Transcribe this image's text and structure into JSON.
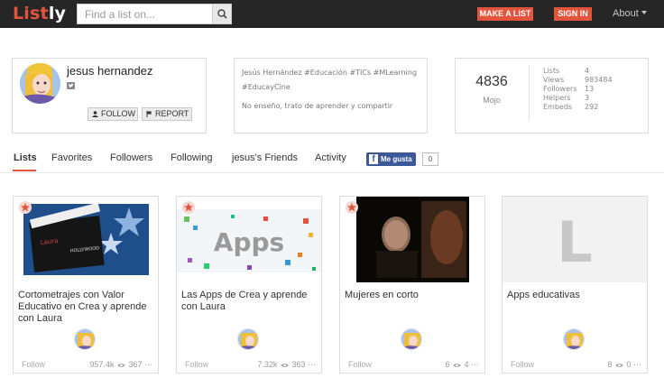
{
  "header": {
    "logo_main": "List",
    "logo_suffix": "ly",
    "search_placeholder": "Find a list on...",
    "make_list_label": "MAKE A LIST",
    "sign_in_label": "SIGN IN",
    "about_label": "About"
  },
  "profile": {
    "name": "jesus hernandez",
    "follow_label": "FOLLOW",
    "report_label": "REPORT",
    "bio_line1": "Jesús Hernández #Educación #TICs #MLearning #EducayCine",
    "bio_line2": "No enseño, trato de aprender y compartir",
    "mojo_value": "4836",
    "mojo_label": "Mojo",
    "stats": [
      {
        "label": "Lists",
        "value": "4"
      },
      {
        "label": "Views",
        "value": "983484"
      },
      {
        "label": "Followers",
        "value": "13"
      },
      {
        "label": "Helpers",
        "value": "3"
      },
      {
        "label": "Embeds",
        "value": "292"
      }
    ]
  },
  "tabs": [
    {
      "label": "Lists",
      "active": true
    },
    {
      "label": "Favorites"
    },
    {
      "label": "Followers"
    },
    {
      "label": "Following"
    },
    {
      "label": "jesus's Friends"
    },
    {
      "label": "Activity"
    }
  ],
  "facebook": {
    "like_label": "Me gusta",
    "count": "0"
  },
  "cards": [
    {
      "title": "Cortometrajes con Valor Educativo en Crea y aprende con Laura",
      "follow": "Follow",
      "views": "957.4k",
      "embeds": "367",
      "starred": true,
      "image": "clapperboard"
    },
    {
      "title": "Las Apps de Crea y aprende con Laura",
      "follow": "Follow",
      "views": "7.32k",
      "embeds": "363",
      "starred": true,
      "image": "apps"
    },
    {
      "title": "Mujeres en corto",
      "follow": "Follow",
      "views": "6",
      "embeds": "4",
      "starred": true,
      "image": "film-still"
    },
    {
      "title": "Apps educativas",
      "follow": "Follow",
      "views": "8",
      "embeds": "0",
      "starred": false,
      "image": "letter",
      "image_letter": "L"
    }
  ],
  "colors": {
    "accent": "#e2543c",
    "topbar": "#262626",
    "facebook": "#3b5998"
  }
}
